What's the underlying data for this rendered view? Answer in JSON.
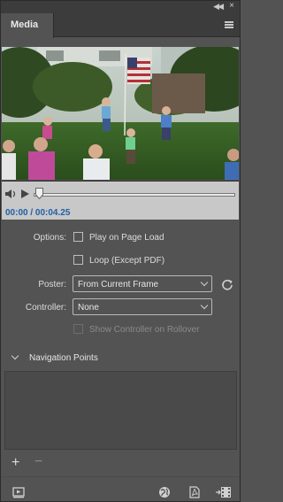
{
  "panel": {
    "tab_label": "Media",
    "icons": [
      "collapse-icon",
      "close-icon",
      "panel-menu-icon"
    ]
  },
  "video": {
    "description_icon": "video-preview",
    "timecode": "00:00 / 00:04.25"
  },
  "options": {
    "label": "Options:",
    "play_on_load": {
      "label": "Play on Page Load",
      "checked": false
    },
    "loop": {
      "label": "Loop (Except PDF)",
      "checked": false
    }
  },
  "poster": {
    "label": "Poster:",
    "value": "From Current Frame"
  },
  "controller": {
    "label": "Controller:",
    "value": "None",
    "show_on_rollover": {
      "label": "Show Controller on Rollover",
      "checked": false,
      "disabled": true
    }
  },
  "navigation_points": {
    "title": "Navigation Points",
    "items": []
  },
  "footer": {
    "icons": [
      "preview-icon",
      "globe-icon",
      "pdf-icon",
      "media-import-icon"
    ]
  }
}
